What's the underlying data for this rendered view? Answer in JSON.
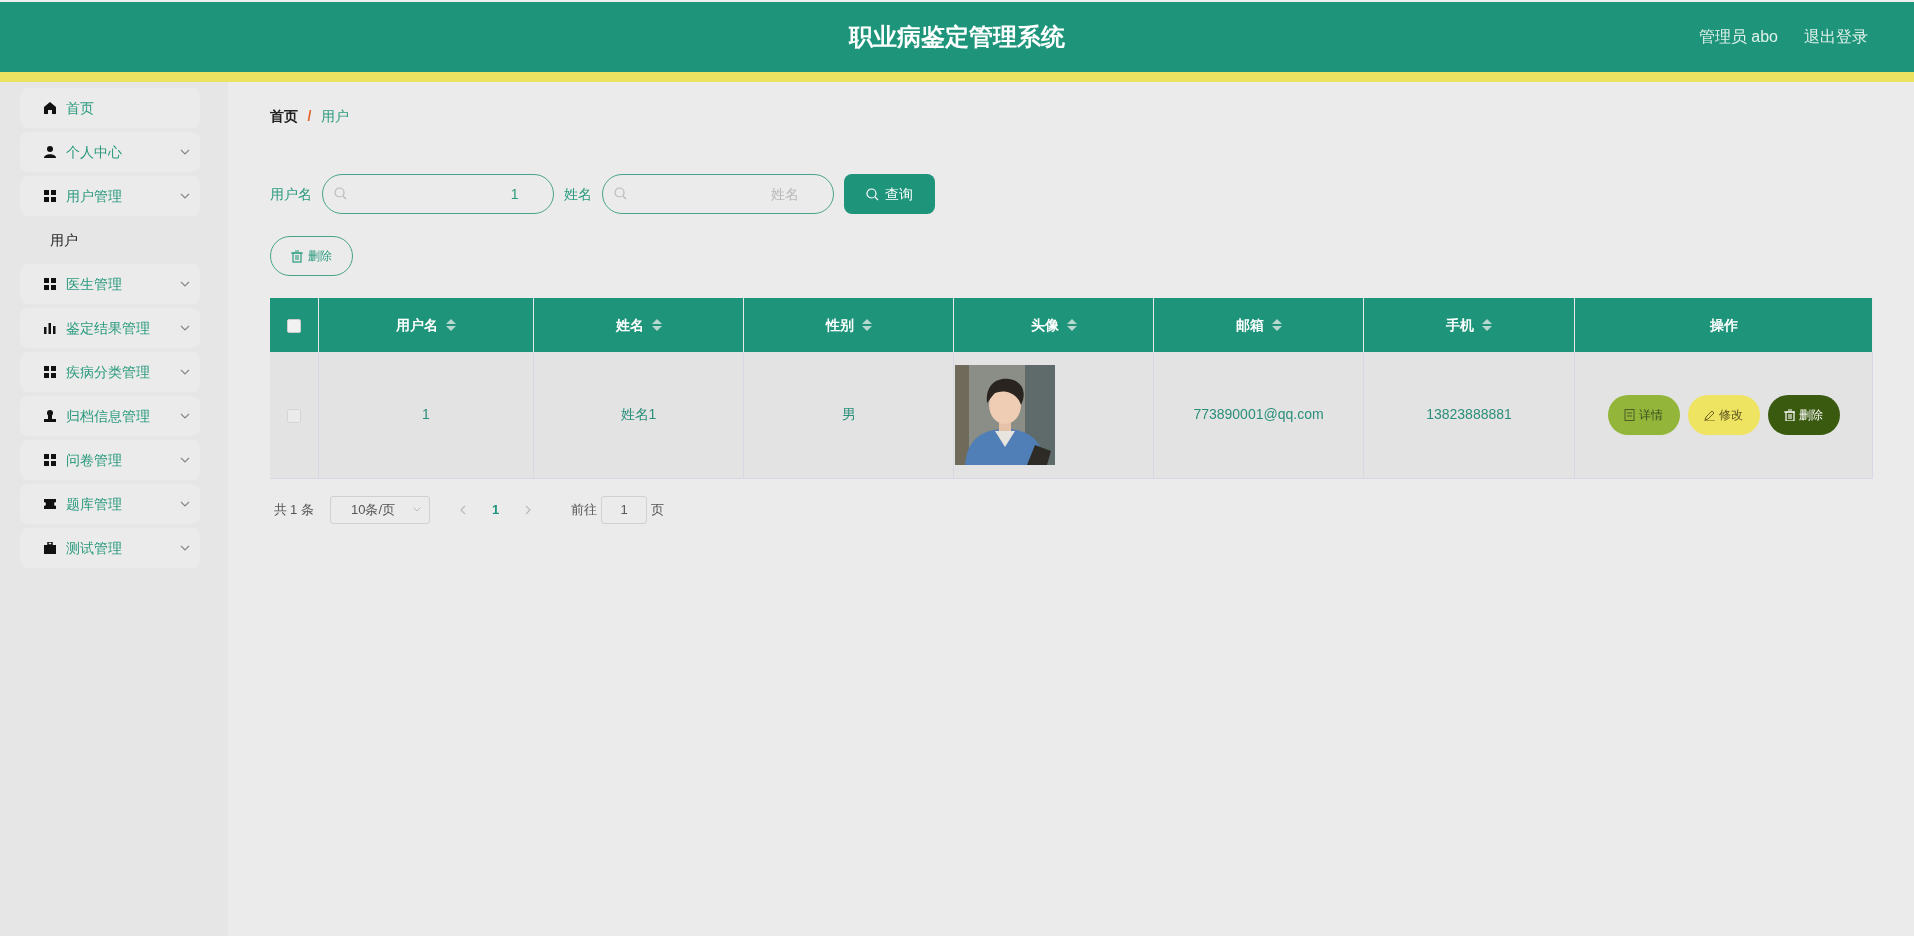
{
  "header": {
    "title": "职业病鉴定管理系统",
    "user": "管理员 abo",
    "logout": "退出登录"
  },
  "sidebar": {
    "items": [
      {
        "label": "首页",
        "kind": "home",
        "expandable": false
      },
      {
        "label": "个人中心",
        "kind": "user",
        "expandable": true
      },
      {
        "label": "用户管理",
        "kind": "grid",
        "expandable": true,
        "children": [
          {
            "label": "用户"
          }
        ]
      },
      {
        "label": "医生管理",
        "kind": "grid",
        "expandable": true
      },
      {
        "label": "鉴定结果管理",
        "kind": "chart",
        "expandable": true
      },
      {
        "label": "疾病分类管理",
        "kind": "grid",
        "expandable": true
      },
      {
        "label": "归档信息管理",
        "kind": "stamp",
        "expandable": true
      },
      {
        "label": "问卷管理",
        "kind": "grid",
        "expandable": true
      },
      {
        "label": "题库管理",
        "kind": "ticket",
        "expandable": true
      },
      {
        "label": "测试管理",
        "kind": "briefcase",
        "expandable": true
      }
    ]
  },
  "breadcrumb": {
    "separator": "/",
    "items": [
      {
        "label": "首页"
      },
      {
        "label": "用户"
      }
    ]
  },
  "search": {
    "fields": [
      {
        "label": "用户名",
        "value": "1"
      },
      {
        "label": "姓名",
        "placeholder": "姓名"
      }
    ],
    "button": "查询"
  },
  "toolbar": {
    "delete": "删除"
  },
  "table": {
    "select_all": {
      "checked": false
    },
    "columns": [
      {
        "label": "用户名",
        "sortable": true
      },
      {
        "label": "姓名",
        "sortable": true
      },
      {
        "label": "性别",
        "sortable": true
      },
      {
        "label": "头像",
        "sortable": true
      },
      {
        "label": "邮箱",
        "sortable": true
      },
      {
        "label": "手机",
        "sortable": true
      },
      {
        "label": "操作",
        "sortable": false
      }
    ],
    "rows": [
      {
        "checked": false,
        "cells": [
          "1",
          "姓名1",
          "男",
          {
            "kind": "picture"
          },
          "773890001@qq.com",
          "13823888881"
        ],
        "actions": [
          {
            "label": "详情",
            "kind": "view"
          },
          {
            "label": "修改",
            "kind": "edit"
          },
          {
            "label": "删除",
            "kind": "delete"
          }
        ]
      }
    ]
  },
  "pagination": {
    "total": "共 1 条",
    "page_size": "10条/页",
    "pages": [
      {
        "label": "1",
        "selected": true
      }
    ],
    "goto_label": "前往",
    "goto_value": "1",
    "goto_suffix": "页"
  }
}
